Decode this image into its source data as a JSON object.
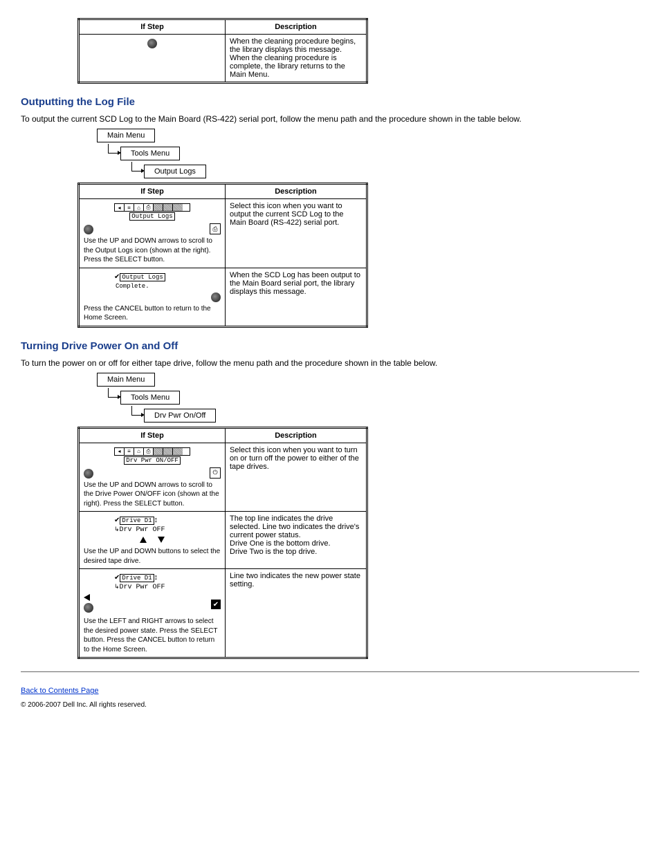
{
  "table0": {
    "col1": "If Step",
    "col2": "Description",
    "row_desc": "When the cleaning procedure begins, the library displays this message. When the cleaning procedure is complete, the library returns to the Main Menu."
  },
  "sec1": {
    "heading": "Outputting the Log File",
    "para": "To output the current SCD Log to the Main Board (RS-422) serial port, follow the menu path and the procedure shown in the table below.",
    "crumb1": "Main Menu",
    "crumb2": "Tools Menu",
    "crumb3": "Output Logs",
    "table": {
      "col1": "If Step",
      "col2": "Description",
      "r1_lcd": "Output Logs",
      "r1_instr": "Use the UP and DOWN arrows to scroll to the Output Logs icon (shown at the right). Press the SELECT button.",
      "r1_desc": "Select this icon when you want to output the current SCD Log to the Main Board (RS-422) serial port.",
      "r2_lcd_l1": "Output Logs",
      "r2_lcd_l2": "Complete.",
      "r2_instr": "Press the CANCEL button to return to the Home Screen.",
      "r2_desc": "When the SCD Log has been output to the Main Board serial port, the library displays this message."
    }
  },
  "sec2": {
    "heading": "Turning Drive Power On and Off",
    "para": "To turn the power on or off for either tape drive, follow the menu path and the procedure shown in the table below.",
    "crumb1": "Main Menu",
    "crumb2": "Tools Menu",
    "crumb3": "Drv Pwr On/Off",
    "table": {
      "col1": "If Step",
      "col2": "Description",
      "r1_lcd": "Drv Pwr ON/OFF",
      "r1_instr": "Use the UP and DOWN arrows to scroll to the Drive Power ON/OFF icon (shown at the right). Press the SELECT button.",
      "r1_desc": "Select this icon when you want to turn on or turn off the power to either of the tape drives.",
      "r2_lcd_l1": "Drive D1",
      "r2_lcd_l2": "Drv Pwr OFF",
      "r2_instr": "Use the UP and DOWN buttons to select the desired tape drive.",
      "r2_desc_l1": "The top line indicates the drive selected. Line two indicates the drive's current power status.",
      "r2_desc_l2": "Drive One is the bottom drive.",
      "r2_desc_l3": "Drive Two is the top drive.",
      "r3_lcd_l1": "Drive D1",
      "r3_lcd_l2": "Drv Pwr OFF",
      "r3_instr": "Use the LEFT and RIGHT arrows to select the desired power state. Press the SELECT button. Press the CANCEL button to return to the Home Screen.",
      "r3_desc": "Line two indicates the new power state setting."
    }
  },
  "footer": {
    "link": "Back to Contents Page",
    "copyright": "© 2006-2007 Dell Inc. All rights reserved."
  }
}
